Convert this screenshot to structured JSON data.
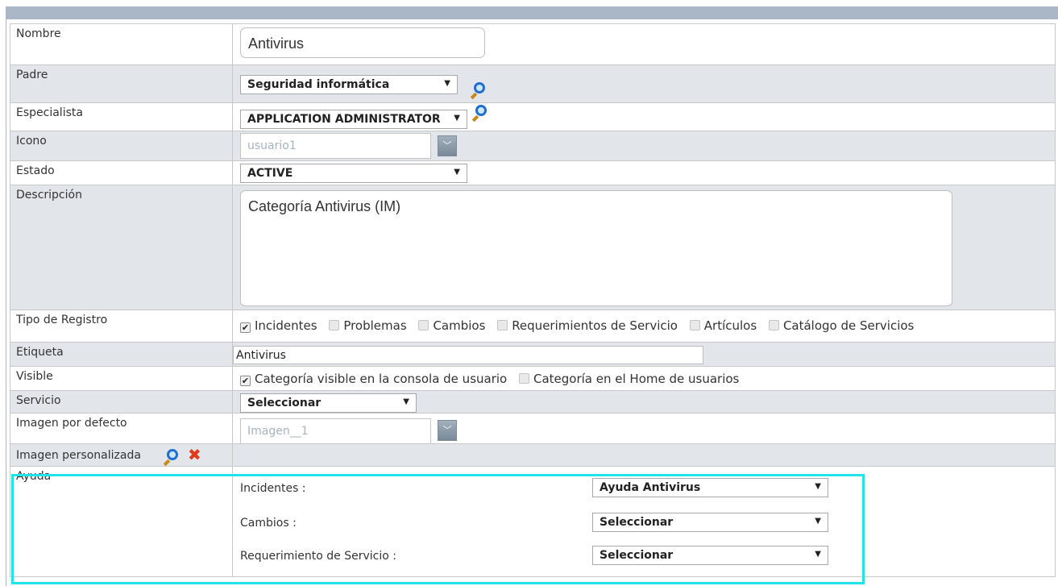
{
  "form": {
    "nombre": {
      "label": "Nombre",
      "value": "Antivirus"
    },
    "padre": {
      "label": "Padre",
      "value": "Seguridad informática"
    },
    "especialista": {
      "label": "Especialista",
      "value": "APPLICATION ADMINISTRATOR"
    },
    "icono": {
      "label": "Icono",
      "value": "usuario1"
    },
    "estado": {
      "label": "Estado",
      "value": "ACTIVE"
    },
    "descripcion": {
      "label": "Descripción",
      "value": "Categoría Antivirus (IM)"
    },
    "tipo_registro": {
      "label": "Tipo de Registro",
      "options": [
        {
          "label": "Incidentes",
          "checked": true
        },
        {
          "label": "Problemas",
          "checked": false
        },
        {
          "label": "Cambios",
          "checked": false
        },
        {
          "label": "Requerimientos de Servicio",
          "checked": false
        },
        {
          "label": "Artículos",
          "checked": false
        },
        {
          "label": "Catálogo de Servicios",
          "checked": false
        }
      ]
    },
    "etiqueta": {
      "label": "Etiqueta",
      "value": "Antivirus"
    },
    "visible": {
      "label": "Visible",
      "options": [
        {
          "label": "Categoría visible en la consola de usuario",
          "checked": true
        },
        {
          "label": "Categoría en el Home de usuarios",
          "checked": false
        }
      ]
    },
    "servicio": {
      "label": "Servicio",
      "value": "Seleccionar"
    },
    "imagen_defecto": {
      "label": "Imagen por defecto",
      "value": "Imagen__1"
    },
    "imagen_personalizada": {
      "label": "Imagen personalizada"
    },
    "ayuda": {
      "label": "Ayuda",
      "rows": [
        {
          "label": "Incidentes :",
          "value": "Ayuda Antivirus"
        },
        {
          "label": "Cambios :",
          "value": "Seleccionar"
        },
        {
          "label": "Requerimiento de Servicio :",
          "value": "Seleccionar"
        }
      ]
    }
  },
  "icons": {
    "search": "magnifier-icon",
    "remove": "red-x-icon",
    "dropdown": "chevron-down-icon"
  },
  "colors": {
    "header_bar": "#a9b7c7",
    "row_gray": "#e2e6ea",
    "highlight": "#22e3e8",
    "remove": "#e23b1c"
  }
}
